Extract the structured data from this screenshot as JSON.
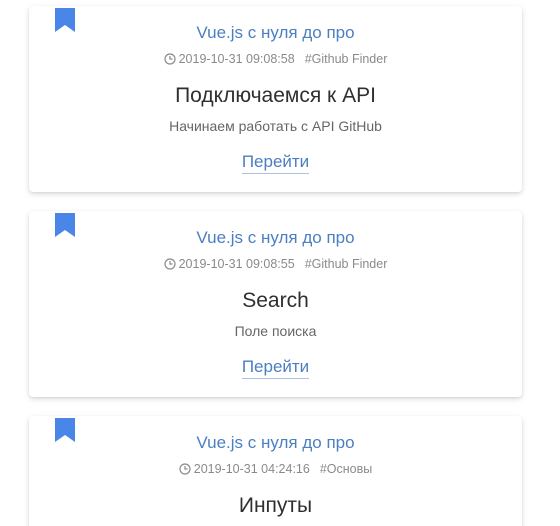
{
  "colors": {
    "accent": "#4a7fc1",
    "bookmark": "#4a86e8",
    "meta_text": "#8a8a8a",
    "title_text": "#2f2f2f",
    "description_text": "#666666"
  },
  "posts": [
    {
      "course": "Vue.js с нуля до про",
      "timestamp": "2019-10-31 09:08:58",
      "tag": "#Github Finder",
      "title": "Подключаемся к API",
      "description": "Начинаем работать с API GitHub",
      "link_label": "Перейти",
      "bookmark_icon": "bookmark-icon",
      "clock_icon": "clock-icon"
    },
    {
      "course": "Vue.js с нуля до про",
      "timestamp": "2019-10-31 09:08:55",
      "tag": "#Github Finder",
      "title": "Search",
      "description": "Поле поиска",
      "link_label": "Перейти",
      "bookmark_icon": "bookmark-icon",
      "clock_icon": "clock-icon"
    },
    {
      "course": "Vue.js с нуля до про",
      "timestamp": "2019-10-31 04:24:16",
      "tag": "#Основы",
      "title": "Инпуты",
      "bookmark_icon": "bookmark-icon",
      "clock_icon": "clock-icon"
    }
  ]
}
